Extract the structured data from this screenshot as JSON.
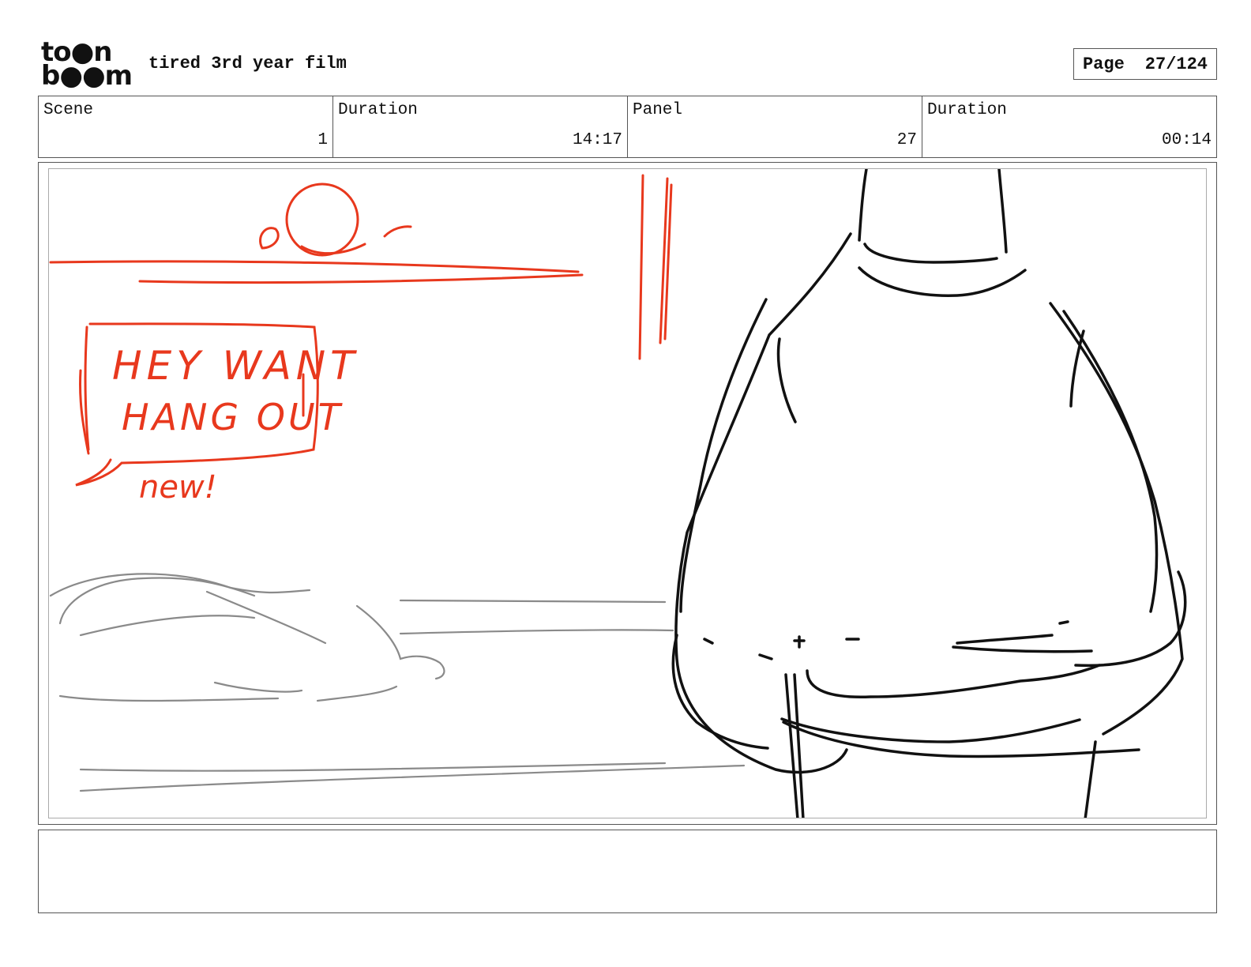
{
  "header": {
    "logo_line1": "to●n",
    "logo_line2": "b●●m",
    "film_title": "tired 3rd year film",
    "page_label": "Page",
    "page_value": "27/124"
  },
  "info": {
    "scene_label": "Scene",
    "scene_value": "1",
    "scene_duration_label": "Duration",
    "scene_duration_value": "14:17",
    "panel_label": "Panel",
    "panel_value": "27",
    "panel_duration_label": "Duration",
    "panel_duration_value": "00:14"
  },
  "sketch": {
    "bubble_line1": "HEY WANT",
    "bubble_line2": "HANG OUT",
    "bubble_tail_text": "new!",
    "accent_color": "#e8381d",
    "ink_color": "#111111",
    "rough_color": "#8a8a8a"
  },
  "notes": {
    "text": ""
  }
}
